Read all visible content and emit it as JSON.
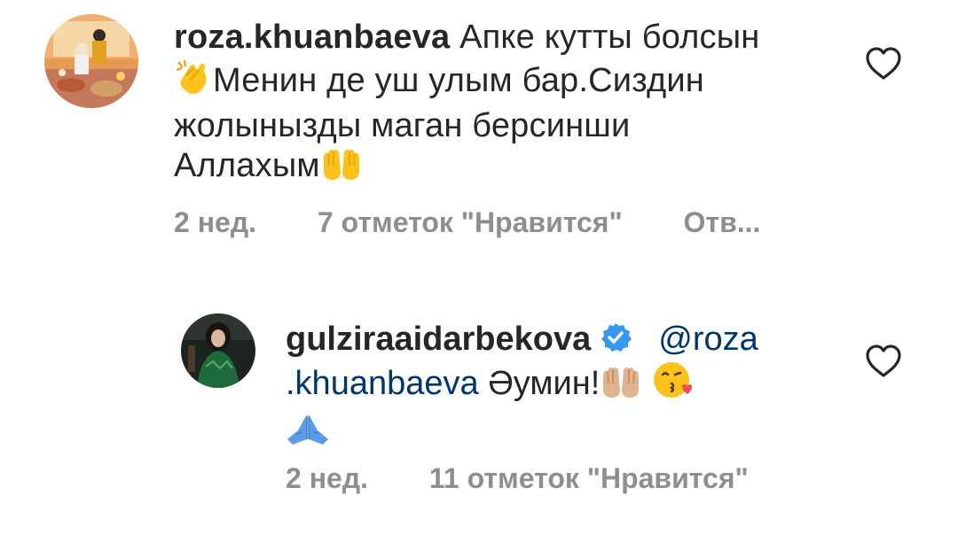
{
  "comments": [
    {
      "username": "roza.khuanbaeva",
      "text_line1": "Апке кутты болсын",
      "text_line2": "Менин де уш улым бар.Сиздин",
      "text_line3": "жолынызды маган берсинши",
      "text_line4": "Аллахым",
      "emoji_clap": "clapping-hands-emoji",
      "emoji_palms": "palms-up-emoji",
      "time": "2 нед.",
      "likes": "7 отметок \"Нравится\"",
      "reply_action": "Отв..."
    },
    {
      "username": "gulziraaidarbekova",
      "verified": true,
      "mention_part1": "@roza",
      "mention_part2": ".khuanbaeva",
      "text": "Әумин!",
      "emoji_palms": "palms-up-emoji-light-skin",
      "emoji_kiss": "face-blowing-kiss-emoji",
      "emoji_pray": "folded-hands-emoji",
      "time": "2 нед.",
      "likes": "11 отметок \"Нравится\""
    }
  ],
  "colors": {
    "text": "#262626",
    "meta": "#8e8e8e",
    "mention": "#00376b",
    "verified": "#3897f0"
  }
}
